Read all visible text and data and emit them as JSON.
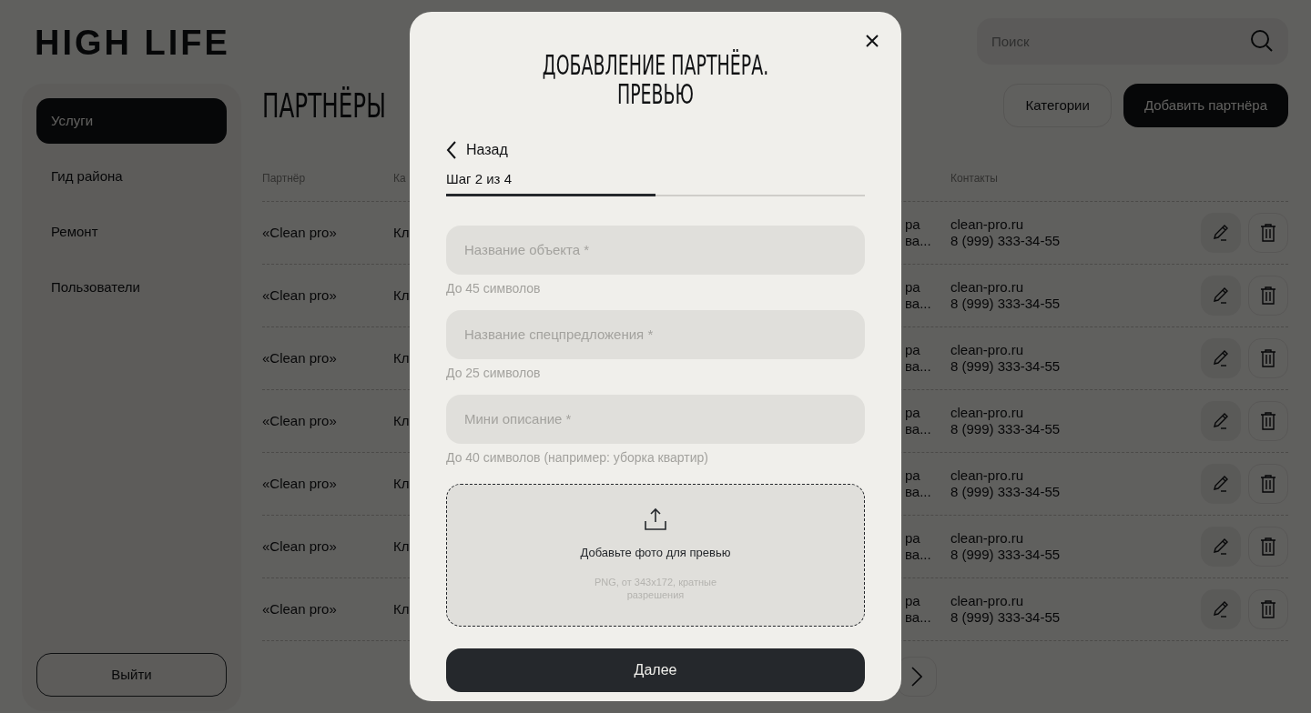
{
  "logo": "HIGH LIFE",
  "sidebar": {
    "items": [
      {
        "label": "Услуги",
        "selected": true
      },
      {
        "label": "Гид района",
        "selected": false
      },
      {
        "label": "Ремонт",
        "selected": false
      },
      {
        "label": "Пользователи",
        "selected": false
      }
    ],
    "logout": "Выйти"
  },
  "page_title": "ПАРТНЁРЫ",
  "search": {
    "placeholder": "Поиск"
  },
  "header_buttons": [
    {
      "label": "Категории",
      "kind": "outline"
    },
    {
      "label": "Добавить партнёра",
      "kind": "primary"
    }
  ],
  "table": {
    "columns": [
      {
        "label": "Партнёр"
      },
      {
        "label": "Ка"
      },
      {
        "label": "Контакты"
      }
    ],
    "rows": [
      {
        "partner": "«Clean pro»",
        "category": "Кл",
        "column_3": [
          "ра",
          "ва..."
        ],
        "site": "clean-pro.ru",
        "phone": "8 (999) 333-34-55"
      },
      {
        "partner": "«Clean pro»",
        "category": "Кл",
        "column_3": [
          "ра",
          "ва..."
        ],
        "site": "clean-pro.ru",
        "phone": "8 (999) 333-34-55"
      },
      {
        "partner": "«Clean pro»",
        "category": "Кл",
        "column_3": [
          "ра",
          "ва..."
        ],
        "site": "clean-pro.ru",
        "phone": "8 (999) 333-34-55"
      },
      {
        "partner": "«Clean pro»",
        "category": "Кл",
        "column_3": [
          "ра",
          "ва..."
        ],
        "site": "clean-pro.ru",
        "phone": "8 (999) 333-34-55"
      },
      {
        "partner": "«Clean pro»",
        "category": "Кл",
        "column_3": [
          "ра",
          "ва..."
        ],
        "site": "clean-pro.ru",
        "phone": "8 (999) 333-34-55"
      },
      {
        "partner": "«Clean pro»",
        "category": "Кл",
        "column_3": [
          "ра",
          "ва..."
        ],
        "site": "clean-pro.ru",
        "phone": "8 (999) 333-34-55"
      },
      {
        "partner": "«Clean pro»",
        "category": "Кл",
        "column_3": [
          "ра",
          "ва..."
        ],
        "site": "clean-pro.ru",
        "phone": "8 (999) 333-34-55"
      }
    ]
  },
  "modal": {
    "title_lines": [
      "ДОБАВЛЕНИЕ ПАРТНЁРА.",
      "ПРЕВЬЮ"
    ],
    "back": "Назад",
    "step": "Шаг 2 из 4",
    "progress": {
      "level": 0.5
    },
    "fields": [
      {
        "placeholder": "Название объекта *",
        "hint": "До 45 символов"
      },
      {
        "placeholder": "Название спецпредложения *",
        "hint": "До 25 символов"
      },
      {
        "placeholder": "Мини описание *",
        "hint": "До 40 символов (например: уборка квартир)"
      }
    ],
    "upload": {
      "label": "Добавьте фото для превью",
      "note": "PNG, от 343x172, кратные разрешения"
    },
    "submit": "Далее"
  }
}
